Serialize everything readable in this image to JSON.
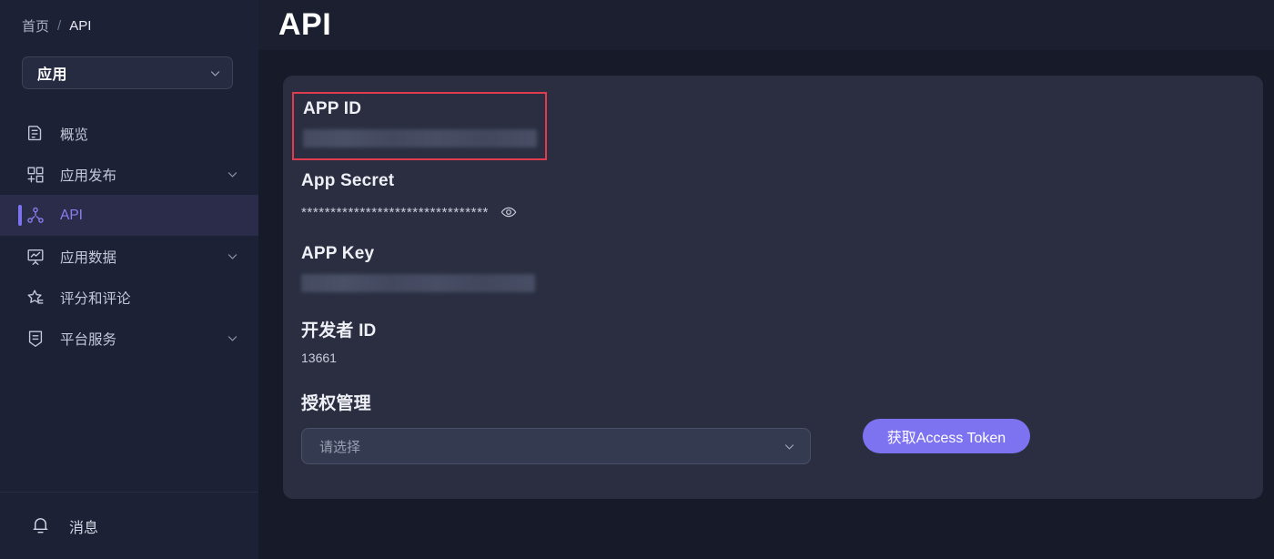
{
  "breadcrumb": {
    "home": "首页",
    "separator": "/",
    "current": "API"
  },
  "sidebar": {
    "app_selector": {
      "value": "应用",
      "icon": "chevron-down-icon"
    },
    "items": [
      {
        "label": "概览",
        "icon": "document-report-icon",
        "active": false,
        "has_chevron": false
      },
      {
        "label": "应用发布",
        "icon": "app-grid-plus-icon",
        "active": false,
        "has_chevron": true
      },
      {
        "label": "API",
        "icon": "node-network-icon",
        "active": true,
        "has_chevron": false
      },
      {
        "label": "应用数据",
        "icon": "chart-board-icon",
        "active": false,
        "has_chevron": true
      },
      {
        "label": "评分和评论",
        "icon": "star-lines-icon",
        "active": false,
        "has_chevron": false
      },
      {
        "label": "平台服务",
        "icon": "shield-icon",
        "active": false,
        "has_chevron": true
      }
    ],
    "footer": {
      "label": "消息",
      "icon": "bell-icon"
    }
  },
  "header": {
    "title": "API"
  },
  "card": {
    "app_id": {
      "label": "APP ID",
      "value": "",
      "redacted": true,
      "highlight_color": "#e03c4e"
    },
    "app_secret": {
      "label": "App Secret",
      "value": "********************************",
      "toggle_icon": "eye-icon"
    },
    "app_key": {
      "label": "APP Key",
      "value": "",
      "redacted": true
    },
    "developer_id": {
      "label": "开发者 ID",
      "value": "13661"
    },
    "authorization": {
      "label": "授权管理",
      "select_placeholder": "请选择",
      "select_value": "",
      "chevron_icon": "chevron-down-icon",
      "button_label": "获取Access Token",
      "button_color": "#7d72f0"
    }
  }
}
